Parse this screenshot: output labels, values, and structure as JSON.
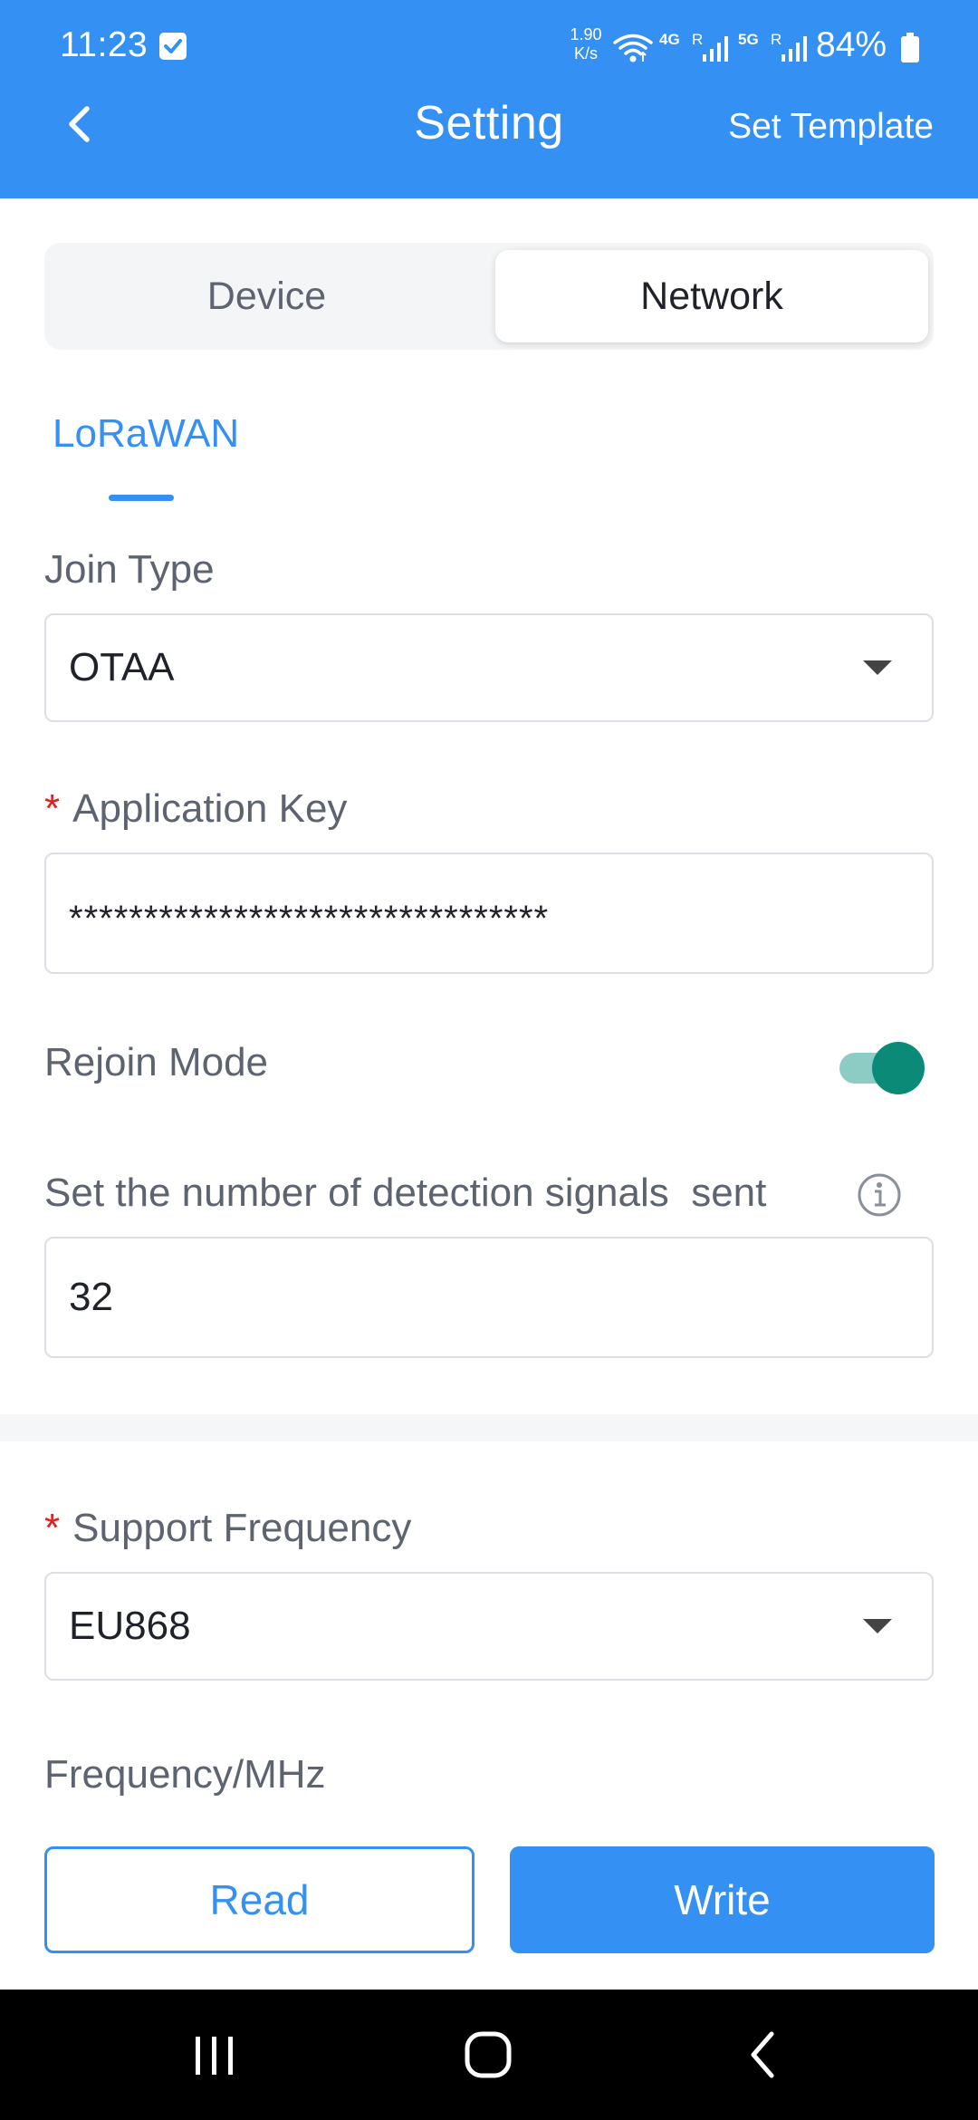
{
  "status_bar": {
    "time": "11:23",
    "speed_value": "1.90",
    "speed_unit": "K/s",
    "net1_label": "4G",
    "net1_roam": "R",
    "net2_label": "5G",
    "net2_roam": "R",
    "battery": "84%",
    "icons": [
      "check-notification-icon",
      "wifi-icon",
      "signal-icon",
      "battery-icon"
    ]
  },
  "header": {
    "title": "Setting",
    "right_action": "Set Template",
    "color": "#3490F2"
  },
  "tabs": {
    "items": [
      "Device",
      "Network"
    ],
    "active": "Network"
  },
  "subtab": {
    "label": "LoRaWAN"
  },
  "form": {
    "join_type": {
      "label": "Join Type",
      "value": "OTAA"
    },
    "application_key": {
      "required_mark": "*",
      "label": "Application Key",
      "value": "********************************"
    },
    "rejoin_mode": {
      "label": "Rejoin Mode",
      "enabled": true,
      "toggle_color": "#0B8A78"
    },
    "detection_signals": {
      "label": "Set the number of detection signals  sent",
      "value": "32"
    },
    "support_frequency": {
      "required_mark": "*",
      "label": "Support Frequency",
      "value": "EU868"
    },
    "frequency": {
      "label": "Frequency/MHz"
    }
  },
  "actions": {
    "read": "Read",
    "write": "Write"
  },
  "nav_bar": {
    "icons": [
      "recent-apps-icon",
      "home-icon",
      "back-icon"
    ]
  }
}
